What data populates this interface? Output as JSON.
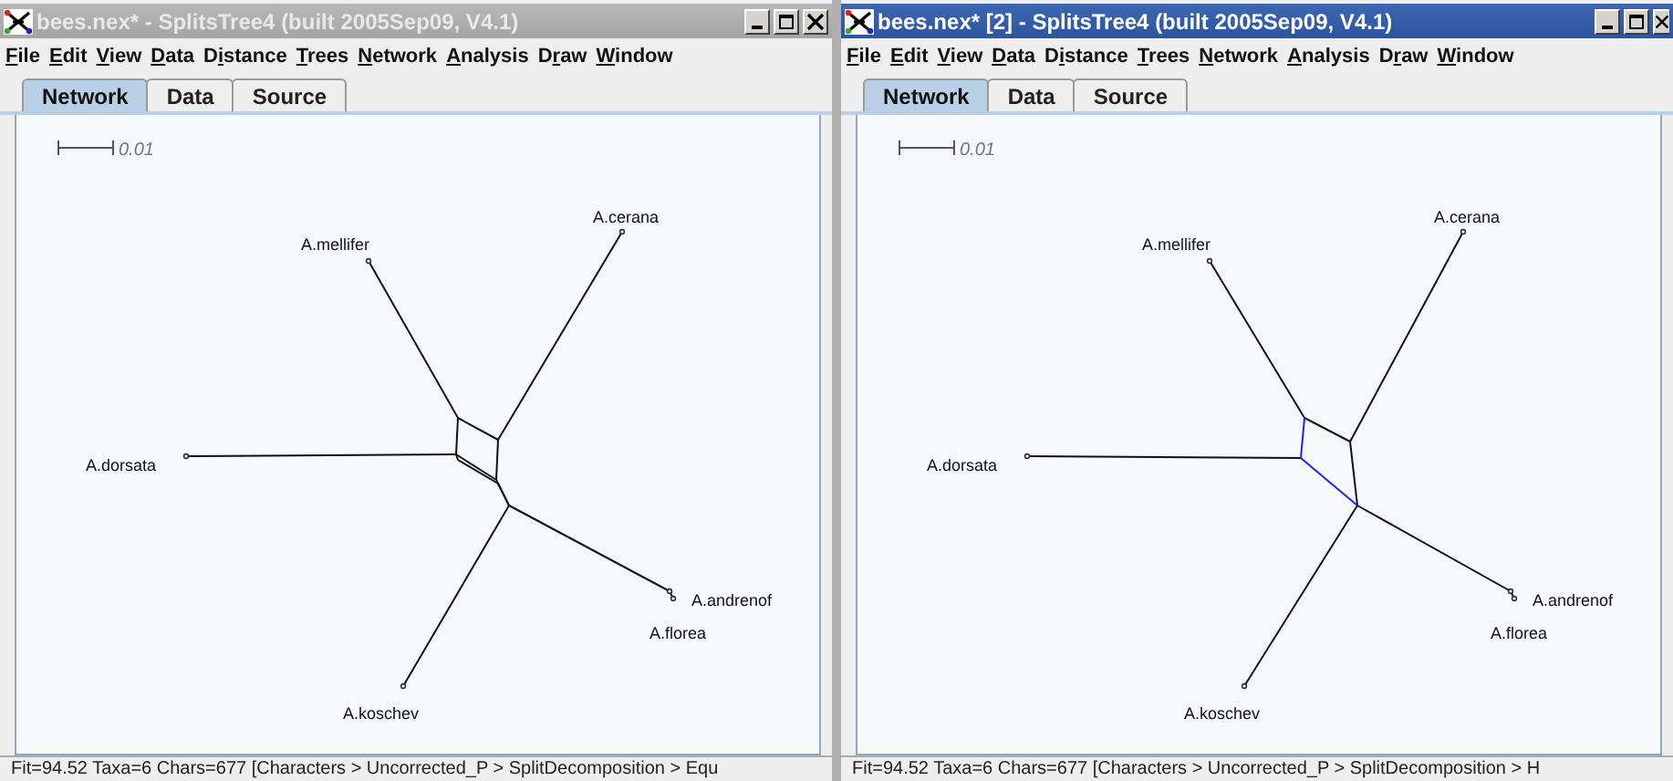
{
  "windows": [
    {
      "title": "bees.nex* - SplitsTree4 (built 2005Sep09, V4.1)",
      "active": false,
      "close_cut": false,
      "menu": [
        {
          "label": "File"
        },
        {
          "label": "Edit"
        },
        {
          "label": "View"
        },
        {
          "label": "Data"
        },
        {
          "label": "Distance"
        },
        {
          "label": "Trees"
        },
        {
          "label": "Network"
        },
        {
          "label": "Analysis"
        },
        {
          "label": "Draw"
        },
        {
          "label": "Window"
        }
      ],
      "tabs": [
        {
          "label": "Network",
          "selected": true
        },
        {
          "label": "Data",
          "selected": false
        },
        {
          "label": "Source",
          "selected": false
        }
      ],
      "network": {
        "kind": "box",
        "scale": "0.01",
        "taxa": [
          {
            "label": "A.cerana"
          },
          {
            "label": "A.mellifer"
          },
          {
            "label": "A.dorsata"
          },
          {
            "label": "A.andrenof"
          },
          {
            "label": "A.florea"
          },
          {
            "label": "A.koschev"
          }
        ]
      },
      "status_bar": "Fit=94.52 Taxa=6 Chars=677 [Characters > Uncorrected_P > SplitDecomposition > Equ"
    },
    {
      "title": "bees.nex* [2] - SplitsTree4 (built 2005Sep09, V4.1)",
      "active": true,
      "close_cut": true,
      "menu": [
        {
          "label": "File"
        },
        {
          "label": "Edit"
        },
        {
          "label": "View"
        },
        {
          "label": "Data"
        },
        {
          "label": "Distance"
        },
        {
          "label": "Trees"
        },
        {
          "label": "Network"
        },
        {
          "label": "Analysis"
        },
        {
          "label": "Draw"
        },
        {
          "label": "Window"
        }
      ],
      "tabs": [
        {
          "label": "Network",
          "selected": true
        },
        {
          "label": "Data",
          "selected": false
        },
        {
          "label": "Source",
          "selected": false
        }
      ],
      "network": {
        "kind": "split",
        "scale": "0.01",
        "split_selected": true,
        "taxa": [
          {
            "label": "A.cerana"
          },
          {
            "label": "A.mellifer"
          },
          {
            "label": "A.dorsata"
          },
          {
            "label": "A.andrenof"
          },
          {
            "label": "A.florea"
          },
          {
            "label": "A.koschev"
          }
        ]
      },
      "status_bar": "Fit=94.52 Taxa=6 Chars=677 [Characters > Uncorrected_P > SplitDecomposition > H"
    }
  ]
}
